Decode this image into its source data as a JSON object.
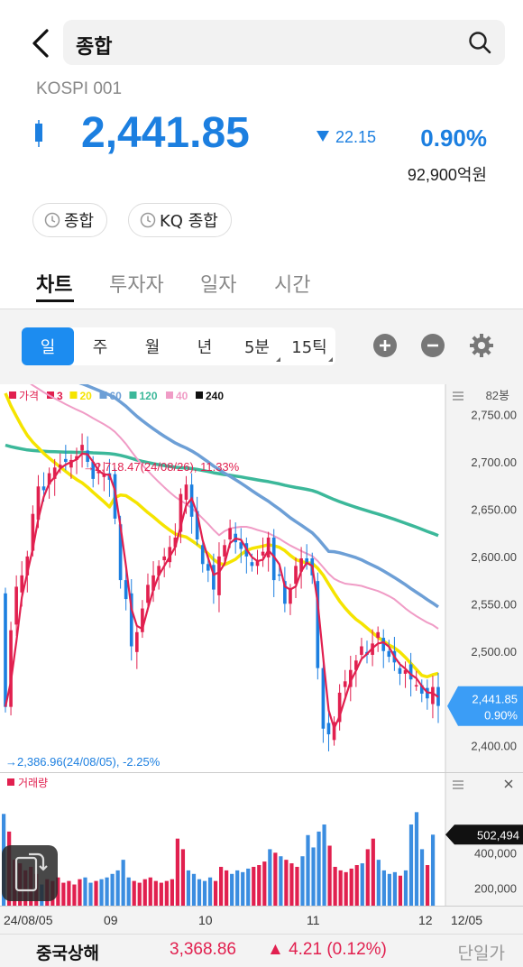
{
  "header": {
    "search_text": "종합"
  },
  "quote": {
    "code": "KOSPI 001",
    "price": "2,441.85",
    "change": "22.15",
    "change_pct": "0.90%",
    "volume": "92,900억원",
    "color_down": "#1c7fe0"
  },
  "chips": [
    {
      "label": "종합"
    },
    {
      "label": "KQ 종합"
    }
  ],
  "tabs": [
    {
      "label": "차트",
      "active": true
    },
    {
      "label": "투자자"
    },
    {
      "label": "일자"
    },
    {
      "label": "시간"
    }
  ],
  "periods": [
    {
      "label": "일",
      "active": true
    },
    {
      "label": "주"
    },
    {
      "label": "월"
    },
    {
      "label": "년"
    },
    {
      "label": "5분",
      "menu": true
    },
    {
      "label": "15틱",
      "menu": true
    }
  ],
  "controls": {
    "zoom_in_icon": "plus-circle-icon",
    "zoom_out_icon": "minus-circle-icon",
    "settings_icon": "gear-icon"
  },
  "chart_data": {
    "type": "candlestick",
    "legend": [
      {
        "label": "가격",
        "color": "#e1204f"
      },
      {
        "label": "3",
        "color": "#e1204f"
      },
      {
        "label": "20",
        "color": "#f5e400"
      },
      {
        "label": "60",
        "color": "#6d9fd6"
      },
      {
        "label": "120",
        "color": "#3cb89a"
      },
      {
        "label": "40",
        "color": "#f09cc6"
      },
      {
        "label": "240",
        "color": "#111111"
      }
    ],
    "candle_count_label": "82봉",
    "y_ticks": [
      "2,750.00",
      "2,700.00",
      "2,650.00",
      "2,600.00",
      "2,550.00",
      "2,500.00",
      "2,400.00"
    ],
    "y_tick_values": [
      2750,
      2700,
      2650,
      2600,
      2550,
      2500,
      2400
    ],
    "ylim": [
      2372,
      2782
    ],
    "current_price": "2,441.85",
    "current_pct": "0.90%",
    "current_value": 2441.85,
    "high_annotation": "→2,718.47(24/08/26), 11.33%",
    "low_annotation": "→2,386.96(24/08/05), -2.25%",
    "x_labels": [
      "24/08/05",
      "09",
      "10",
      "11",
      "12",
      "12/05"
    ],
    "x_label_index": [
      0,
      17,
      32,
      47,
      62,
      82
    ],
    "close": [
      2441,
      2522,
      2568,
      2580,
      2600,
      2645,
      2674,
      2670,
      2688,
      2694,
      2697,
      2700,
      2702,
      2706,
      2718,
      2700,
      2682,
      2690,
      2688,
      2681,
      2640,
      2575,
      2555,
      2505,
      2520,
      2545,
      2570,
      2580,
      2590,
      2600,
      2610,
      2620,
      2666,
      2676,
      2642,
      2618,
      2592,
      2585,
      2565,
      2600,
      2612,
      2630,
      2615,
      2608,
      2600,
      2590,
      2595,
      2605,
      2620,
      2575,
      2580,
      2550,
      2565,
      2590,
      2598,
      2592,
      2580,
      2482,
      2418,
      2412,
      2425,
      2456,
      2468,
      2480,
      2490,
      2505,
      2496,
      2508,
      2520,
      2500,
      2494,
      2488,
      2476,
      2480,
      2470,
      2464,
      2455,
      2450,
      2462,
      2442
    ],
    "volume_ylim": [
      100000,
      780000
    ],
    "volume_ticks": [
      "400,000",
      "200,000"
    ],
    "volume_tick_values": [
      400000,
      200000
    ],
    "volume_series": [
      620000,
      520000,
      360000,
      340000,
      300000,
      320000,
      280000,
      220000,
      250000,
      240000,
      260000,
      230000,
      240000,
      220000,
      250000,
      260000,
      230000,
      240000,
      250000,
      260000,
      280000,
      300000,
      360000,
      260000,
      240000,
      230000,
      250000,
      260000,
      240000,
      230000,
      240000,
      250000,
      480000,
      420000,
      300000,
      280000,
      250000,
      240000,
      260000,
      240000,
      320000,
      300000,
      280000,
      300000,
      290000,
      310000,
      320000,
      330000,
      350000,
      420000,
      400000,
      380000,
      360000,
      340000,
      320000,
      380000,
      500000,
      430000,
      520000,
      560000,
      440000,
      320000,
      300000,
      290000,
      310000,
      330000,
      340000,
      420000,
      480000,
      360000,
      300000,
      280000,
      290000,
      270000,
      300000,
      560000,
      630000,
      420000,
      330000,
      502494
    ],
    "volume_current": "502,494",
    "volume_label": "거래량"
  },
  "bottom": {
    "name": "중국상해",
    "price": "3,368.86",
    "change": "▲ 4.21 (0.12%)",
    "unit_price_label": "단일가"
  }
}
